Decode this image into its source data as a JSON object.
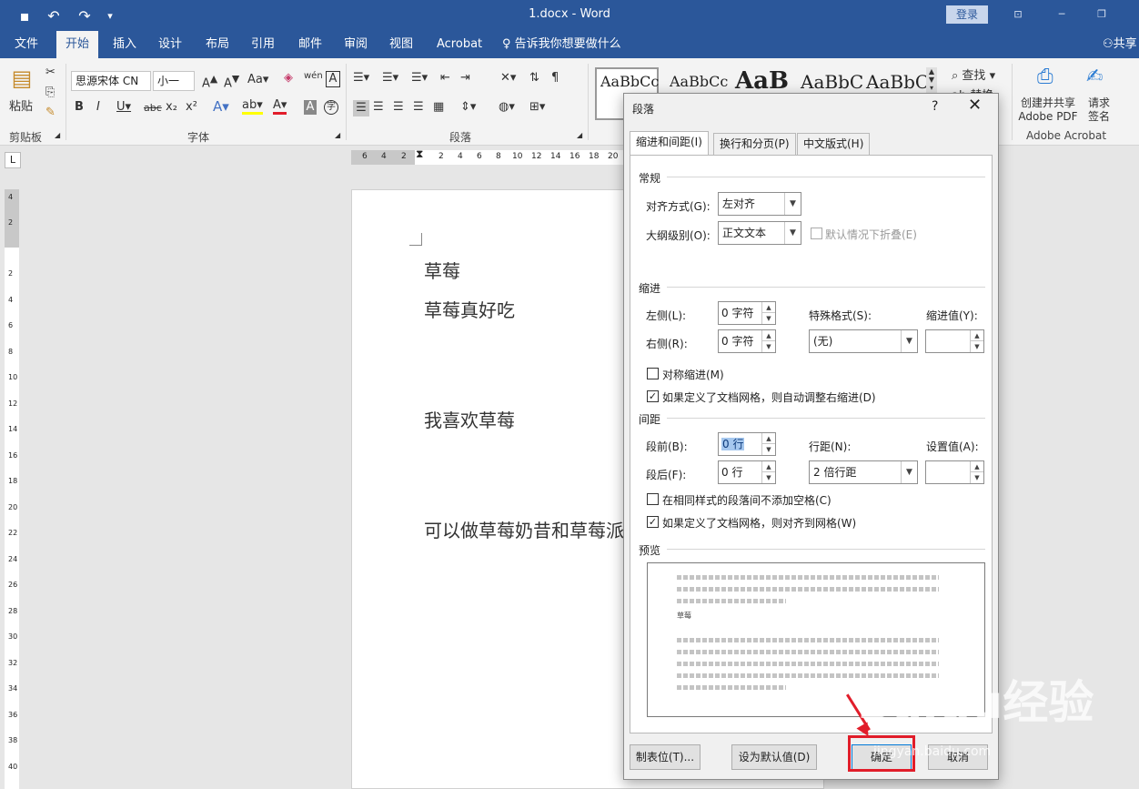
{
  "app": {
    "doc_title": "1.docx - Word",
    "login": "登录"
  },
  "tabs": [
    "文件",
    "开始",
    "插入",
    "设计",
    "布局",
    "引用",
    "邮件",
    "审阅",
    "视图",
    "Acrobat"
  ],
  "tell_me": "告诉我你想要做什么",
  "share": "共享",
  "ribbon": {
    "paste": "粘贴",
    "clipboard_label": "剪贴板",
    "font_name": "思源宋体 CN",
    "font_size": "小一",
    "font_label": "字体",
    "paragraph_label": "段落",
    "find": "查找",
    "replace": "替换",
    "styles": [
      "AaBbCc",
      "AaBbCc",
      "AaB",
      "AaBbC",
      "AaBbC"
    ],
    "acrobat_create": "创建并共享 Adobe PDF",
    "acrobat_sign": "请求签名",
    "acrobat_label": "Adobe Acrobat"
  },
  "ruler": {
    "top_ticks": [
      "6",
      "4",
      "2",
      "2",
      "4",
      "6",
      "8",
      "10",
      "12",
      "14",
      "16",
      "18",
      "20"
    ],
    "left_ticks": [
      "4",
      "2",
      "2",
      "4",
      "6",
      "8",
      "10",
      "12",
      "14",
      "16",
      "18",
      "20",
      "22",
      "24",
      "26",
      "28",
      "30",
      "32",
      "34",
      "36",
      "38",
      "40"
    ]
  },
  "document": {
    "lines": [
      "草莓",
      "草莓真好吃",
      "我喜欢草莓",
      "可以做草莓奶昔和草莓派"
    ]
  },
  "dialog": {
    "title": "段落",
    "help": "?",
    "close": "✕",
    "tabs": [
      "缩进和间距(I)",
      "换行和分页(P)",
      "中文版式(H)"
    ],
    "general": {
      "title": "常规",
      "alignment_label": "对齐方式(G):",
      "alignment_value": "左对齐",
      "outline_label": "大纲级别(O):",
      "outline_value": "正文文本",
      "collapse_label": "默认情况下折叠(E)"
    },
    "indent": {
      "title": "缩进",
      "left_label": "左侧(L):",
      "left_value": "0 字符",
      "right_label": "右侧(R):",
      "right_value": "0 字符",
      "special_label": "特殊格式(S):",
      "special_value": "(无)",
      "by_label": "缩进值(Y):",
      "mirror_label": "对称缩进(M)",
      "auto_adjust_label": "如果定义了文档网格，则自动调整右缩进(D)"
    },
    "spacing": {
      "title": "间距",
      "before_label": "段前(B):",
      "before_value": "0 行",
      "after_label": "段后(F):",
      "after_value": "0 行",
      "line_label": "行距(N):",
      "line_value": "2 倍行距",
      "at_label": "设置值(A):",
      "no_space_label": "在相同样式的段落间不添加空格(C)",
      "snap_label": "如果定义了文档网格，则对齐到网格(W)"
    },
    "preview": {
      "title": "预览",
      "sample": "草莓"
    },
    "buttons": {
      "tabs": "制表位(T)...",
      "default": "设为默认值(D)",
      "ok": "确定",
      "cancel": "取消"
    }
  },
  "watermark": {
    "brand": "Baidu经验",
    "url": "jingyan.baidu.com"
  }
}
